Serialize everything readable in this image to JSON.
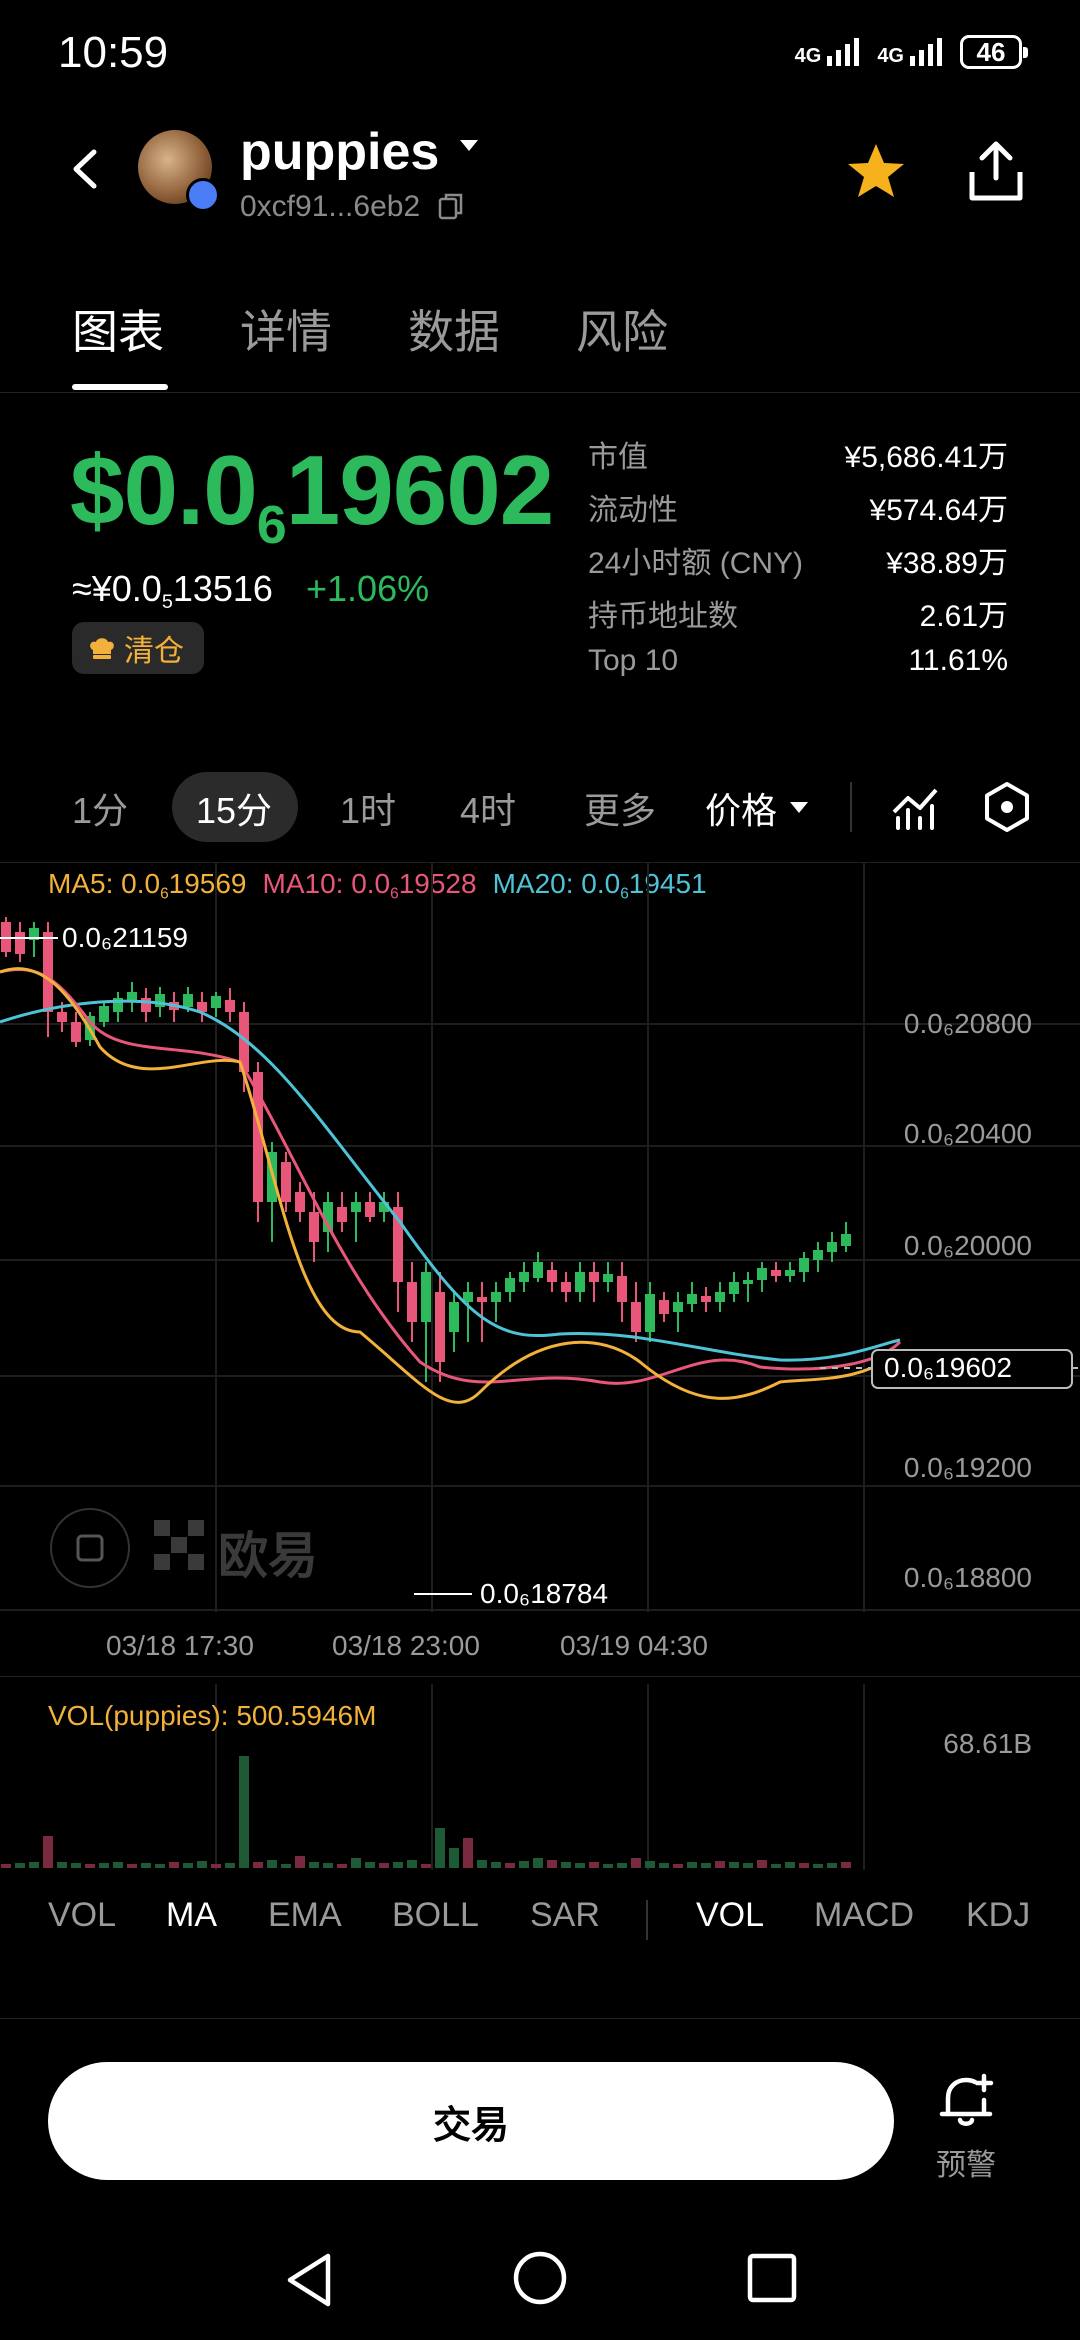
{
  "status": {
    "time": "10:59",
    "net1": "4G",
    "net2": "4G",
    "battery": "46"
  },
  "header": {
    "token_name": "puppies",
    "address": "0xcf91...6eb2"
  },
  "tabs": [
    "图表",
    "详情",
    "数据",
    "风险"
  ],
  "price": {
    "usd_prefix": "$0.0",
    "usd_zeros": "6",
    "usd_digits": "19602",
    "cny_prefix": "≈¥0.0",
    "cny_zeros": "5",
    "cny_digits": "13516",
    "change": "+1.06%",
    "badge": "清仓"
  },
  "stats": [
    {
      "label": "市值",
      "value": "¥5,686.41万"
    },
    {
      "label": "流动性",
      "value": "¥574.64万"
    },
    {
      "label": "24小时额 (CNY)",
      "value": "¥38.89万"
    },
    {
      "label": "持币地址数",
      "value": "2.61万"
    },
    {
      "label": "Top 10",
      "value": "11.61%"
    }
  ],
  "intervals": [
    "1分",
    "15分",
    "1时",
    "4时",
    "更多"
  ],
  "price_selector": "价格",
  "ma_legend": {
    "ma5": {
      "label": "MA5: 0.0",
      "zeros": "6",
      "digits": "19569",
      "color": "#f2b13a"
    },
    "ma10": {
      "label": "MA10: 0.0",
      "zeros": "6",
      "digits": "19528",
      "color": "#e8577a"
    },
    "ma20": {
      "label": "MA20: 0.0",
      "zeros": "6",
      "digits": "19451",
      "color": "#4ec3d6"
    }
  },
  "chart_data": {
    "type": "candlestick",
    "y_axis_labels": [
      "0.0₆20800",
      "0.0₆20400",
      "0.0₆20000",
      "0.0₆19600",
      "0.0₆19200",
      "0.0₆18800"
    ],
    "y_values": [
      2.08e-07,
      2.04e-07,
      2e-07,
      1.96e-07,
      1.92e-07,
      1.88e-07
    ],
    "high_label": "0.0₆21159",
    "low_label": "0.0₆18784",
    "current_label": "0.0₆19602",
    "x_labels": [
      "03/18 17:30",
      "03/18 23:00",
      "03/19 04:30"
    ],
    "colors": {
      "up": "#2cba5c",
      "down": "#e8577a"
    }
  },
  "volume": {
    "label": "VOL(puppies): 500.5946M",
    "max_label": "68.61B"
  },
  "indicators_main": [
    "VOL",
    "MA",
    "EMA",
    "BOLL",
    "SAR"
  ],
  "indicators_sub": [
    "VOL",
    "MACD",
    "KDJ"
  ],
  "watermark": "欧易",
  "bottom": {
    "trade": "交易",
    "alert": "预警"
  }
}
